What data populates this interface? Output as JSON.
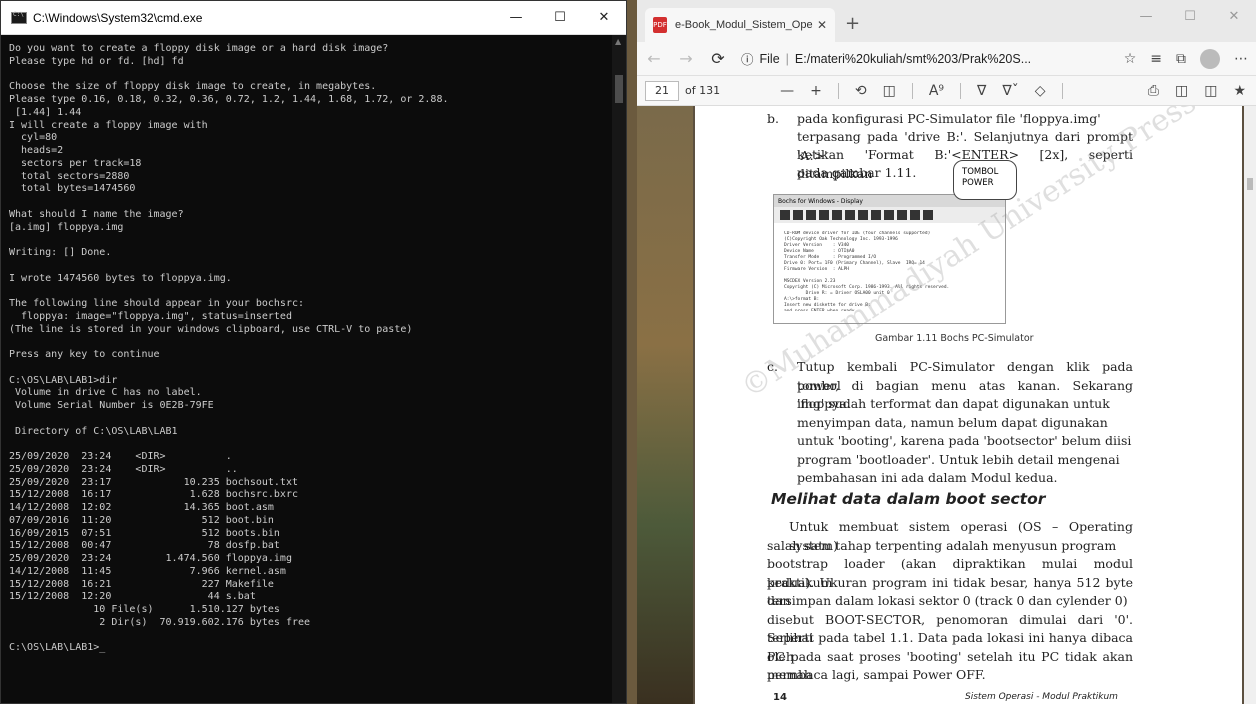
{
  "cmd": {
    "title": "C:\\Windows\\System32\\cmd.exe",
    "lines": [
      "Do you want to create a floppy disk image or a hard disk image?",
      "Please type hd or fd. [hd] fd",
      "",
      "Choose the size of floppy disk image to create, in megabytes.",
      "Please type 0.16, 0.18, 0.32, 0.36, 0.72, 1.2, 1.44, 1.68, 1.72, or 2.88.",
      " [1.44] 1.44",
      "I will create a floppy image with",
      "  cyl=80",
      "  heads=2",
      "  sectors per track=18",
      "  total sectors=2880",
      "  total bytes=1474560",
      "",
      "What should I name the image?",
      "[a.img] floppya.img",
      "",
      "Writing: [] Done.",
      "",
      "I wrote 1474560 bytes to floppya.img.",
      "",
      "The following line should appear in your bochsrc:",
      "  floppya: image=\"floppya.img\", status=inserted",
      "(The line is stored in your windows clipboard, use CTRL-V to paste)",
      "",
      "Press any key to continue",
      "",
      "C:\\OS\\LAB\\LAB1>dir",
      " Volume in drive C has no label.",
      " Volume Serial Number is 0E2B-79FE",
      "",
      " Directory of C:\\OS\\LAB\\LAB1",
      "",
      "25/09/2020  23:24    <DIR>          .",
      "25/09/2020  23:24    <DIR>          ..",
      "25/09/2020  23:17            10.235 bochsout.txt",
      "15/12/2008  16:17             1.628 bochsrc.bxrc",
      "14/12/2008  12:02            14.365 boot.asm",
      "07/09/2016  11:20               512 boot.bin",
      "16/09/2015  07:51               512 boots.bin",
      "15/12/2008  00:47                78 dosfp.bat",
      "25/09/2020  23:24         1.474.560 floppya.img",
      "14/12/2008  11:45             7.966 kernel.asm",
      "15/12/2008  16:21               227 Makefile",
      "15/12/2008  12:20                44 s.bat",
      "              10 File(s)      1.510.127 bytes",
      "               2 Dir(s)  70.919.602.176 bytes free",
      "",
      "C:\\OS\\LAB\\LAB1>_"
    ]
  },
  "edge": {
    "tab_title": "e-Book_Modul_Sistem_Operasi.p",
    "url_scheme": "File",
    "url": "E:/materi%20kuliah/smt%203/Prak%20S...",
    "page_current": "21",
    "page_total": "of 131",
    "icons": [
      "back-icon",
      "forward-icon",
      "refresh-icon",
      "info-icon",
      "favorite-icon",
      "collections-icon",
      "profile-icon",
      "more-icon",
      "zoom-out-icon",
      "zoom-in-icon",
      "rotate-icon",
      "fit-page-icon",
      "read-aloud-icon",
      "draw-icon",
      "highlight-icon",
      "erase-icon",
      "print-icon",
      "save-icon",
      "save-as-icon",
      "pin-icon"
    ]
  },
  "doc": {
    "item_b_marker": "b.",
    "item_b_line1": "pada konfigurasi PC-Simulator file 'floppya.img'",
    "item_b_line2": "terpasang pada 'drive B:'. Selanjutnya dari prompt 'A:>'",
    "item_b_line3": "ketikan 'Format B:'<ENTER> [2x], seperti ditampilkan",
    "item_b_line4": "pada gambar 1.11.",
    "figure_window_title": "Bochs for Windows - Display",
    "figure_screen": "CD-ROM device driver for IDE (four channels supported)\n(C)Copyright Oak Technology Inc. 1993-1996\nDriver Version    : V340\nDevice Name       : OTI$A0\nTransfer Mode     : Programmed I/O\nDrive 0: Port= 1F0 (Primary Channel), Slave  IRQ= 14\nFirmware Version  : ALPH\n\nMSCDEX Version 2.23\nCopyright (C) Microsoft Corp. 1986-1993. All rights reserved.\n        Drive R: = Driver OSLA00 unit 0\nA:\\>format B:\nInsert new diskette for drive B:\nand press ENTER when ready...",
    "figure_callout": "TOMBOL\nPOWER",
    "figure_caption": "Gambar 1.11 Bochs PC-Simulator",
    "item_c_marker": "c.",
    "item_c_lines": [
      "Tutup kembali PC-Simulator dengan klik pada tombol",
      "power, di bagian menu atas kanan. Sekarang 'floppya.",
      "img' sudah terformat dan dapat digunakan untuk",
      "menyimpan data, namun belum dapat digunakan",
      "untuk 'booting', karena pada 'bootsector' belum diisi",
      "program 'bootloader'. Untuk lebih detail mengenai",
      "pembahasan ini ada dalam Modul kedua."
    ],
    "section_heading": "Melihat data dalam boot sector",
    "body_lines": [
      "Untuk membuat sistem operasi (OS – Operating system)",
      "salah satu tahap terpenting adalah menyusun program",
      "bootstrap loader (akan dipraktikan mulai modul praktikum",
      "kedua). Ukuran program ini tidak besar, hanya 512 byte dan",
      "tersimpan dalam lokasi sektor 0 (track 0 dan cylender 0)",
      "disebut BOOT-SECTOR, penomoran dimulai dari '0'. Seperti",
      "terlihat pada tabel 1.1. Data pada lokasi ini hanya dibaca oleh",
      "PC pada saat proses 'booting' setelah itu PC tidak akan pernah",
      "membaca lagi, sampai Power OFF."
    ],
    "page_number": "14",
    "footer_title": "Sistem Operasi - Modul Praktikum",
    "watermark": "©Muhammadiyah University Press"
  }
}
